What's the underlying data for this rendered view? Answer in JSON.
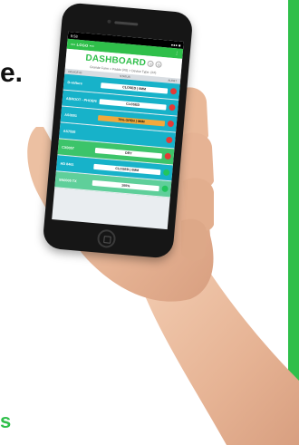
{
  "background_text": {
    "left_fragment": "e.",
    "footer_fragment": "s"
  },
  "colors": {
    "accent_green": "#2fbf4a",
    "row_teal": "#17b2c9",
    "row_green": "#3cc46a",
    "row_mint": "#5fcf9a",
    "dot_red": "#e53935",
    "dot_green": "#22c55e",
    "status_warn": "#f2a93b"
  },
  "phone": {
    "statusbar": {
      "time": "9:58",
      "signal": "●●● ■"
    },
    "appbar": {
      "logo": "••• LOGO •••",
      "menu_icon": "⋮"
    },
    "header": {
      "title": "DASHBOARD",
      "icon_1": "◎",
      "icon_2": "◎",
      "breadcrumb": "Grande Farm > Paddo (#0) > Device Type: (##)"
    },
    "columns": {
      "device": "DEVICE ID",
      "status": "STATUS",
      "alert": "ALERT"
    },
    "rows": [
      {
        "name": "D-valture",
        "status": "CLOSED | 0MM",
        "state": "normal",
        "dot": "red",
        "color": "teal"
      },
      {
        "name": "ABROOT - PHOENIX",
        "status": "CLOSED",
        "state": "normal",
        "dot": "red",
        "color": "teal"
      },
      {
        "name": "AS0001",
        "status": "75% OPEN | 0MM",
        "state": "warn",
        "dot": "red",
        "color": "teal"
      },
      {
        "name": "AS7555",
        "status": "",
        "state": "empty",
        "dot": "red",
        "color": "teal"
      },
      {
        "name": "CX0057",
        "status": "DRY",
        "state": "normal",
        "dot": "red",
        "color": "green"
      },
      {
        "name": "HD 8461",
        "status": "CLOSED | 0MM",
        "state": "normal",
        "dot": "green",
        "color": "teal"
      },
      {
        "name": "SN0005 TX",
        "status": "100%",
        "state": "normal",
        "dot": "green",
        "color": "mint"
      }
    ]
  }
}
